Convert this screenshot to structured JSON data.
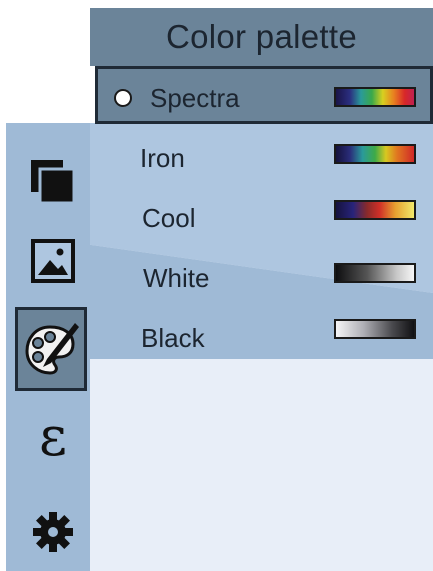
{
  "header": {
    "title": "Color palette"
  },
  "palettes": {
    "selected": {
      "label": "Spectra",
      "swatch_icon": "spectra-gradient"
    },
    "items": [
      {
        "label": "Iron",
        "swatch_icon": "iron-gradient"
      },
      {
        "label": "Cool",
        "swatch_icon": "cool-gradient"
      },
      {
        "label": "White",
        "swatch_icon": "white-hot-gradient"
      },
      {
        "label": "Black",
        "swatch_icon": "black-hot-gradient"
      }
    ]
  },
  "sidebar": {
    "icons": [
      {
        "name": "layers-icon"
      },
      {
        "name": "image-icon"
      },
      {
        "name": "palette-icon",
        "active": true
      },
      {
        "name": "emissivity-icon",
        "glyph": "ε"
      },
      {
        "name": "gear-icon"
      }
    ]
  },
  "colors": {
    "header_bg": "#6b8499",
    "panel_light": "#aec6e0",
    "panel_mid": "#9fbad6",
    "panel_bg": "#e8eef8",
    "text": "#1c2530"
  }
}
